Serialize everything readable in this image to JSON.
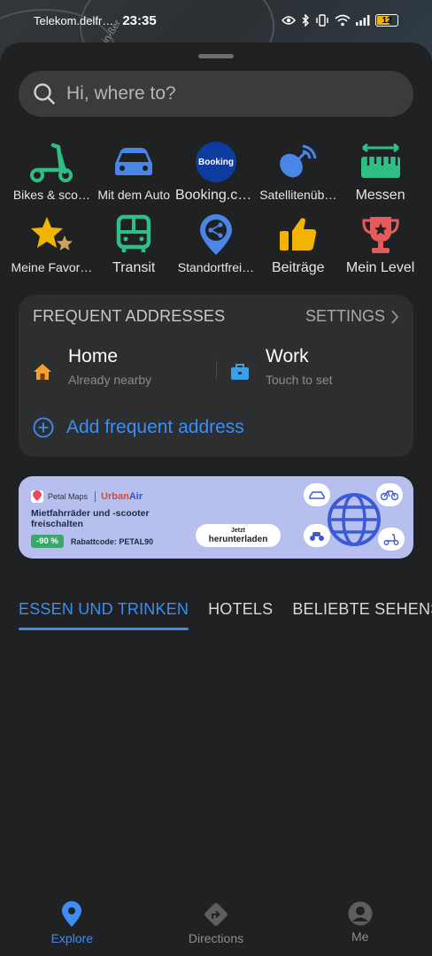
{
  "status_bar": {
    "carrier": "Telekom.delfr…",
    "time": "23:35",
    "battery": "12"
  },
  "map_street_label": "in-ßer",
  "search": {
    "placeholder": "Hi, where to?"
  },
  "shortcuts": [
    {
      "label": "Bikes & sco…",
      "icon": "scooter-icon"
    },
    {
      "label": "Mit dem Auto",
      "icon": "car-icon"
    },
    {
      "label": "Booking.com",
      "icon": "booking-icon",
      "badge_text": "Booking"
    },
    {
      "label": "Satellitenüb…",
      "icon": "satellite-icon"
    },
    {
      "label": "Messen",
      "icon": "ruler-icon"
    },
    {
      "label": "Meine Favor…",
      "icon": "star-icon"
    },
    {
      "label": "Transit",
      "icon": "bus-icon"
    },
    {
      "label": "Standortfrei…",
      "icon": "share-location-icon"
    },
    {
      "label": "Beiträge",
      "icon": "thumbs-up-icon"
    },
    {
      "label": "Mein Level",
      "icon": "trophy-icon"
    }
  ],
  "frequent_addresses": {
    "title": "FREQUENT ADDRESSES",
    "settings_label": "SETTINGS",
    "home": {
      "name": "Home",
      "subtitle": "Already nearby"
    },
    "work": {
      "name": "Work",
      "subtitle": "Touch to set"
    },
    "add_label": "Add frequent address"
  },
  "banner": {
    "brand": "Petal Maps",
    "partner_a": "Urban",
    "partner_b": "Air",
    "headline": "Mietfahrräder und -scooter freischalten",
    "discount": "-90 %",
    "code": "Rabattcode: PETAL90",
    "cta_top": "Jetzt",
    "cta_bottom": "herunterladen"
  },
  "tabs": [
    {
      "label": "ESSEN UND TRINKEN",
      "active": true
    },
    {
      "label": "HOTELS",
      "active": false
    },
    {
      "label": "BELIEBTE SEHENSW",
      "active": false
    }
  ],
  "bottom_nav": [
    {
      "label": "Explore",
      "icon": "location-pin-icon",
      "active": true
    },
    {
      "label": "Directions",
      "icon": "directions-icon",
      "active": false
    },
    {
      "label": "Me",
      "icon": "profile-icon",
      "active": false
    }
  ],
  "colors": {
    "accent": "#3d8df5",
    "sheet_bg": "#202122",
    "card_bg": "#2d2e30"
  }
}
